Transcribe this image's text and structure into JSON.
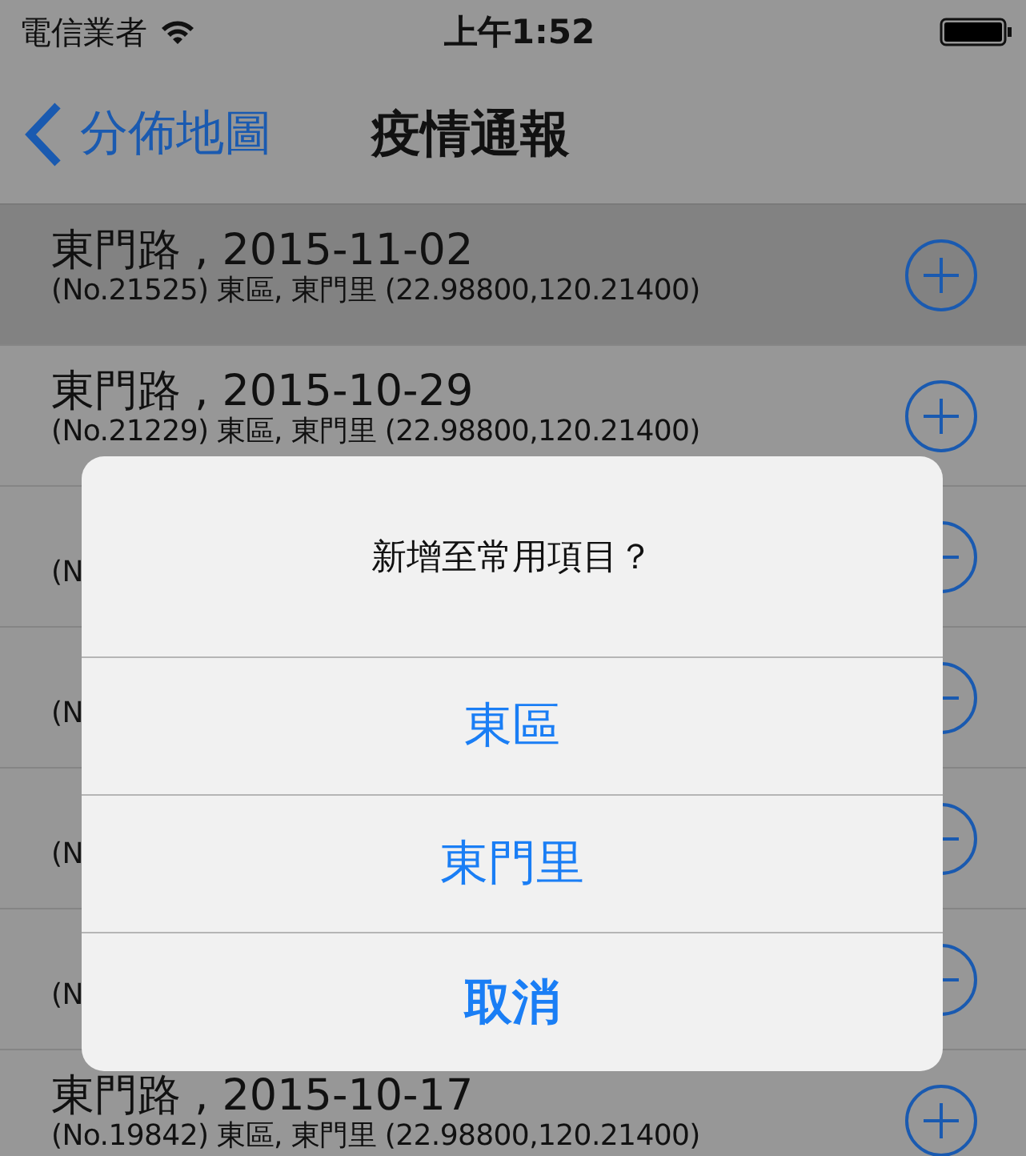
{
  "status_bar": {
    "carrier": "電信業者",
    "time": "上午1:52"
  },
  "nav_bar": {
    "back": "分佈地圖",
    "title": "疫情通報"
  },
  "rows": [
    {
      "kind": "full",
      "title": "東門路 , 2015-11-02",
      "subtitle": "(No.21525) 東區, 東門里 (22.98800,120.21400)",
      "selected": true
    },
    {
      "kind": "full",
      "title": "東門路 , 2015-10-29",
      "subtitle": "(No.21229) 東區, 東門里 (22.98800,120.21400)",
      "selected": false
    },
    {
      "kind": "covered",
      "subtitle": "(N",
      "selected": false
    },
    {
      "kind": "covered",
      "subtitle": "(N",
      "selected": false
    },
    {
      "kind": "covered",
      "subtitle": "(N",
      "selected": false
    },
    {
      "kind": "covered",
      "subtitle": "(N",
      "selected": false
    },
    {
      "kind": "full",
      "title": "東門路 , 2015-10-17",
      "subtitle": "(No.19842) 東區, 東門里 (22.98800,120.21400)",
      "selected": false
    }
  ],
  "alert": {
    "message": "新增至常用項目？",
    "buttons": [
      {
        "label": "東區",
        "kind": "normal"
      },
      {
        "label": "東門里",
        "kind": "normal"
      },
      {
        "label": "取消",
        "kind": "cancel"
      }
    ]
  }
}
